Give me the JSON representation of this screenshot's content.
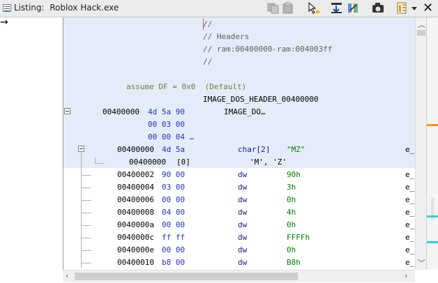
{
  "window": {
    "title_prefix": "Listing:",
    "title_file": "Roblox Hack.exe"
  },
  "toolbar": [
    {
      "name": "copy-icon"
    },
    {
      "name": "paste-icon"
    },
    {
      "name": "cursor-select-icon"
    },
    {
      "name": "field-view-icon"
    },
    {
      "name": "toggle-view-icon"
    },
    {
      "name": "snapshot-icon"
    },
    {
      "name": "edit-fields-icon"
    },
    {
      "name": "dropdown-icon"
    }
  ],
  "listing": {
    "comments": [
      "//",
      "// Headers",
      "// ram:00400000-ram:004003ff",
      "//"
    ],
    "assume": {
      "text": "assume DF = 0x0",
      "note": "(Default)"
    },
    "header_label": "IMAGE_DOS_HEADER_00400000",
    "header_block": {
      "addr": "00400000",
      "bytes1": "4d 5a 90",
      "name": "IMAGE_DO…",
      "bytes2": "00 03 00",
      "bytes3": "00 00 04 …"
    },
    "rows": [
      {
        "addr": "00400000",
        "bytes": "4d 5a",
        "mnem": "char[2]",
        "op": "\"MZ\"",
        "trail": "e_"
      },
      {
        "addr": "00400000",
        "bytes": "[0]",
        "mnem": "",
        "op": "'M', 'Z'",
        "trail": ""
      },
      {
        "addr": "00400002",
        "bytes": "90 00",
        "mnem": "dw",
        "op": "90h",
        "trail": "e_"
      },
      {
        "addr": "00400004",
        "bytes": "03 00",
        "mnem": "dw",
        "op": "3h",
        "trail": "e_"
      },
      {
        "addr": "00400006",
        "bytes": "00 00",
        "mnem": "dw",
        "op": "0h",
        "trail": "e_"
      },
      {
        "addr": "00400008",
        "bytes": "04 00",
        "mnem": "dw",
        "op": "4h",
        "trail": "e_"
      },
      {
        "addr": "0040000a",
        "bytes": "00 00",
        "mnem": "dw",
        "op": "0h",
        "trail": "e_"
      },
      {
        "addr": "0040000c",
        "bytes": "ff ff",
        "mnem": "dw",
        "op": "FFFFh",
        "trail": "e_"
      },
      {
        "addr": "0040000e",
        "bytes": "00 00",
        "mnem": "dw",
        "op": "0h",
        "trail": "e_"
      },
      {
        "addr": "00400010",
        "bytes": "b8 00",
        "mnem": "dw",
        "op": "B8h",
        "trail": "e_"
      }
    ]
  },
  "colors": {
    "selection": "#e3ecf8",
    "bytes": "#2233bb",
    "operand": "#008000",
    "overview_orange": "#ff8c1a",
    "overview_cyan": "#2bd4d4"
  }
}
